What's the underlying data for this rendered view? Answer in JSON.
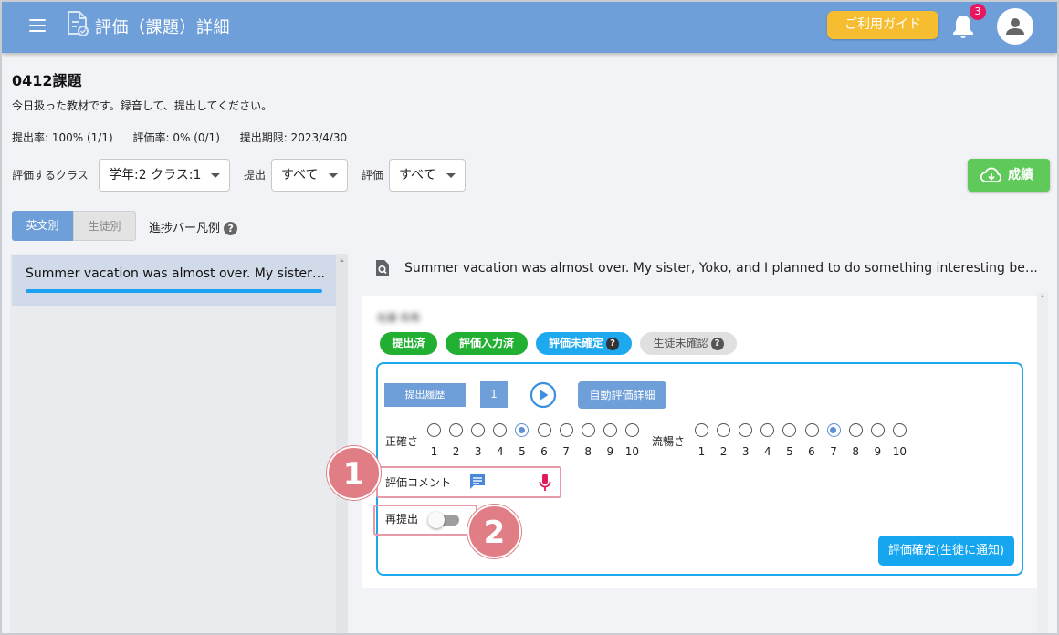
{
  "header": {
    "title": "評価（課題）詳細",
    "guide_label": "ご利用ガイド",
    "notification_count": "3"
  },
  "assignment": {
    "title": "0412課題",
    "description": "今日扱った教材です。録音して、提出してください。",
    "stats": {
      "submission_rate": "提出率: 100% (1/1)",
      "evaluation_rate": "評価率: 0% (0/1)",
      "deadline": "提出期限: 2023/4/30"
    }
  },
  "filters": {
    "class_label": "評価するクラス",
    "class_value": "学年:2 クラス:1",
    "submit_label": "提出",
    "submit_value": "すべて",
    "eval_label": "評価",
    "eval_value": "すべて",
    "grade_button": "成績"
  },
  "tabs": {
    "by_sentence": "英文別",
    "by_student": "生徒別",
    "legend_label": "進捗バー凡例"
  },
  "left_list": {
    "items": [
      {
        "text": "Summer vacation was almost over. My sister, Yoko, and I planned to do something interesting before the end of vacation.",
        "progress": 1.0
      }
    ]
  },
  "detail": {
    "sentence": "Summer vacation was almost over. My sister, Yoko, and I planned to do something interesting before the end of vacation.",
    "student_name": "佐藤 和希",
    "statuses": {
      "submitted": "提出済",
      "entered": "評価入力済",
      "unconfirmed": "評価未確定",
      "student_unchecked": "生徒未確認"
    },
    "history_label": "提出履歴",
    "history_number": "1",
    "auto_eval_label": "自動評価詳細",
    "accuracy_label": "正確さ",
    "accuracy_selected": 5,
    "fluency_label": "流暢さ",
    "fluency_selected": 7,
    "scale": [
      "1",
      "2",
      "3",
      "4",
      "5",
      "6",
      "7",
      "8",
      "9",
      "10"
    ],
    "comment_label": "評価コメント",
    "resubmit_label": "再提出",
    "resubmit_on": false,
    "confirm_button": "評価確定(生徒に通知)"
  },
  "markers": {
    "one": "1",
    "two": "2"
  },
  "colors": {
    "header": "#6f9fd8",
    "guide": "#f5bd2f",
    "grade": "#5fc95a",
    "status_green": "#22b033",
    "status_blue": "#1ea8ee",
    "marker": "#e07d85"
  },
  "icons": [
    "menu-icon",
    "document-check-icon",
    "bell-icon",
    "user-icon",
    "cloud-download-icon",
    "help-icon",
    "search-document-icon",
    "play-icon",
    "chat-icon",
    "mic-icon"
  ]
}
